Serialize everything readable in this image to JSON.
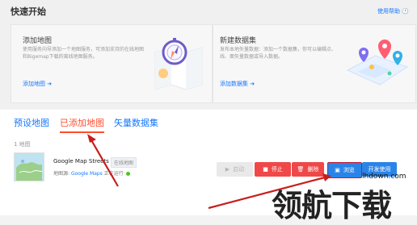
{
  "quick_start": {
    "title": "快速开始",
    "help": "使用帮助 🕐",
    "cards": [
      {
        "title": "添加地图",
        "desc": "使用服务向导添加一个地图服务，可添加支持的在线地图和Bigemap下载的离线地图服务。",
        "link": "添加地图 ➔"
      },
      {
        "title": "新建数据集",
        "desc": "发布本地矢量数据：添加一个数据集，你可以编辑点、线、面矢量数据或导入数据。",
        "link": "添加数据集 ➔"
      }
    ]
  },
  "tabs": [
    "预设地图",
    "已添加地图",
    "矢量数据集"
  ],
  "main": {
    "count": "1 地图",
    "item": {
      "name": "Google Map Streets",
      "tag": "在线地图",
      "source_label": "地图源:",
      "source_value": "Google Maps",
      "status": "正在运行"
    },
    "buttons": {
      "start": "启动",
      "stop": "停止",
      "delete": "删除",
      "browse": "浏览",
      "dev": "开发使用"
    }
  },
  "watermark": {
    "text": "领航下载",
    "url": "lhdown.com"
  },
  "colors": {
    "accent": "#1677ff",
    "active_tab": "#ff4d2e",
    "danger": "#f04848",
    "primary": "#2a84e8",
    "running": "#52c41a"
  }
}
